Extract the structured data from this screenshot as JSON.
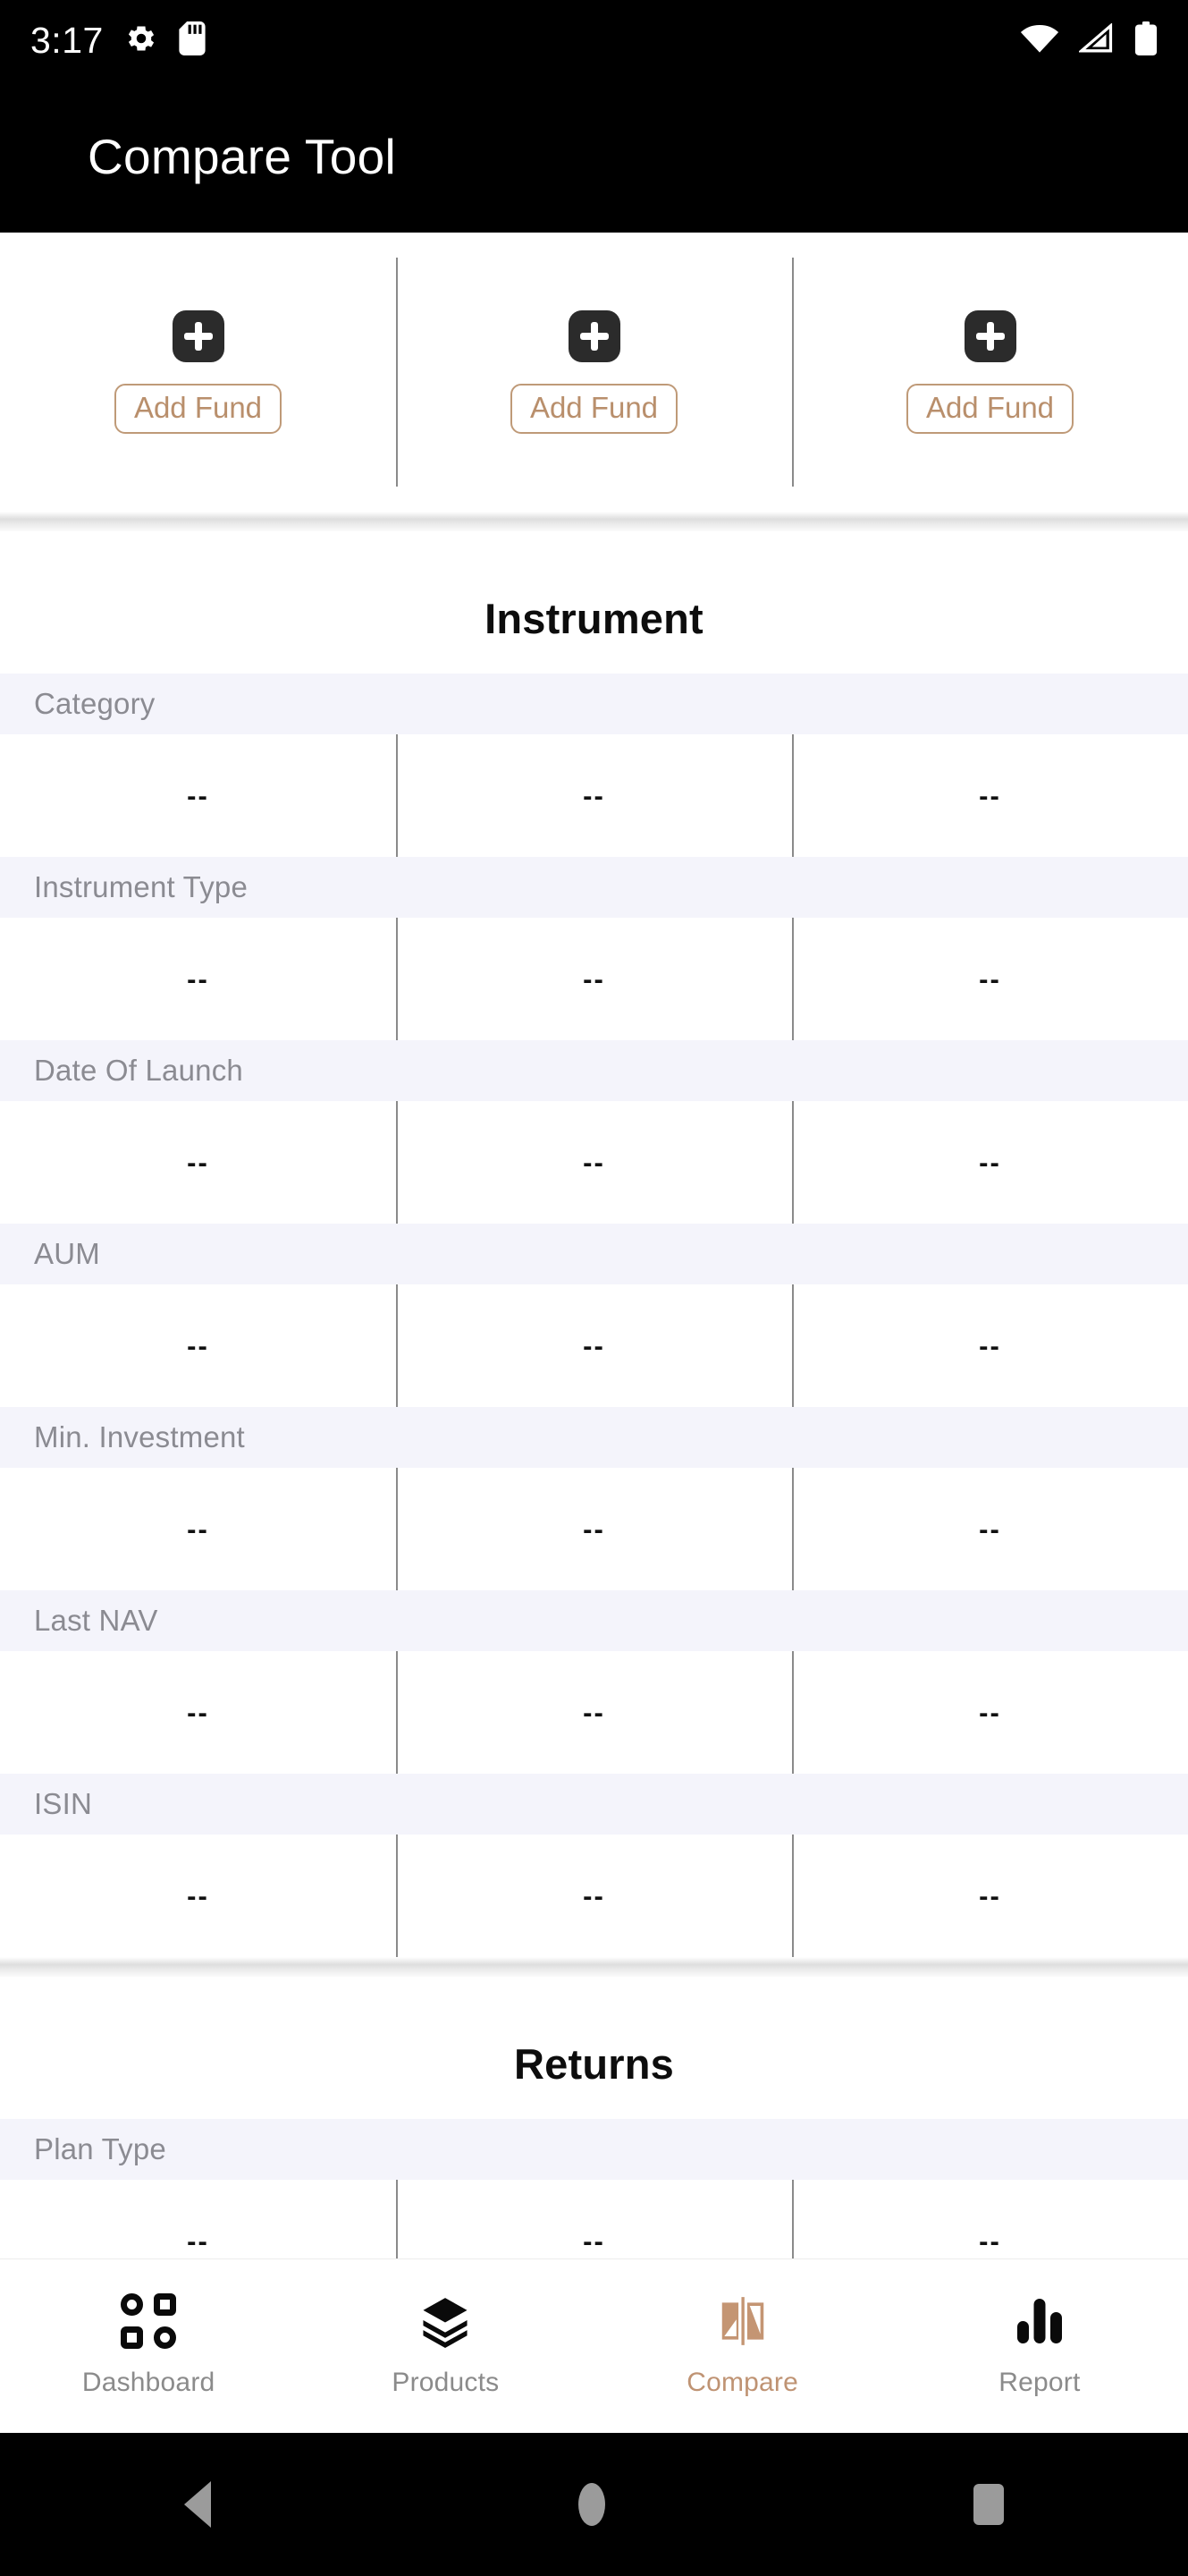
{
  "statusbar": {
    "time": "3:17",
    "left_icons": [
      "gear-icon",
      "sd-card-icon"
    ],
    "right_icons": [
      "wifi-icon",
      "signal-icon",
      "battery-icon"
    ]
  },
  "appbar": {
    "title": "Compare Tool"
  },
  "fund_selector": {
    "columns": [
      {
        "add_label": "Add Fund"
      },
      {
        "add_label": "Add Fund"
      },
      {
        "add_label": "Add Fund"
      }
    ]
  },
  "sections": [
    {
      "title": "Instrument",
      "rows": [
        {
          "label": "Category",
          "values": [
            "--",
            "--",
            "--"
          ]
        },
        {
          "label": "Instrument Type",
          "values": [
            "--",
            "--",
            "--"
          ]
        },
        {
          "label": "Date Of Launch",
          "values": [
            "--",
            "--",
            "--"
          ]
        },
        {
          "label": "AUM",
          "values": [
            "--",
            "--",
            "--"
          ]
        },
        {
          "label": "Min. Investment",
          "values": [
            "--",
            "--",
            "--"
          ]
        },
        {
          "label": "Last NAV",
          "values": [
            "--",
            "--",
            "--"
          ]
        },
        {
          "label": "ISIN",
          "values": [
            "--",
            "--",
            "--"
          ]
        }
      ]
    },
    {
      "title": "Returns",
      "rows": [
        {
          "label": "Plan Type",
          "values": [
            "--",
            "--",
            "--"
          ]
        }
      ]
    }
  ],
  "bottom_nav": {
    "items": [
      {
        "label": "Dashboard",
        "icon": "grid-icon",
        "active": false
      },
      {
        "label": "Products",
        "icon": "layers-icon",
        "active": false
      },
      {
        "label": "Compare",
        "icon": "compare-icon",
        "active": true
      },
      {
        "label": "Report",
        "icon": "bar-chart-icon",
        "active": false
      }
    ]
  },
  "android_nav": {
    "buttons": [
      "back-button",
      "home-button",
      "recents-button"
    ]
  },
  "colors": {
    "accent": "#bf9373",
    "appbar_bg": "#000000",
    "label_band_bg": "#f4f4fb",
    "label_text": "#8b8b92",
    "divider": "#8a8a8a"
  }
}
